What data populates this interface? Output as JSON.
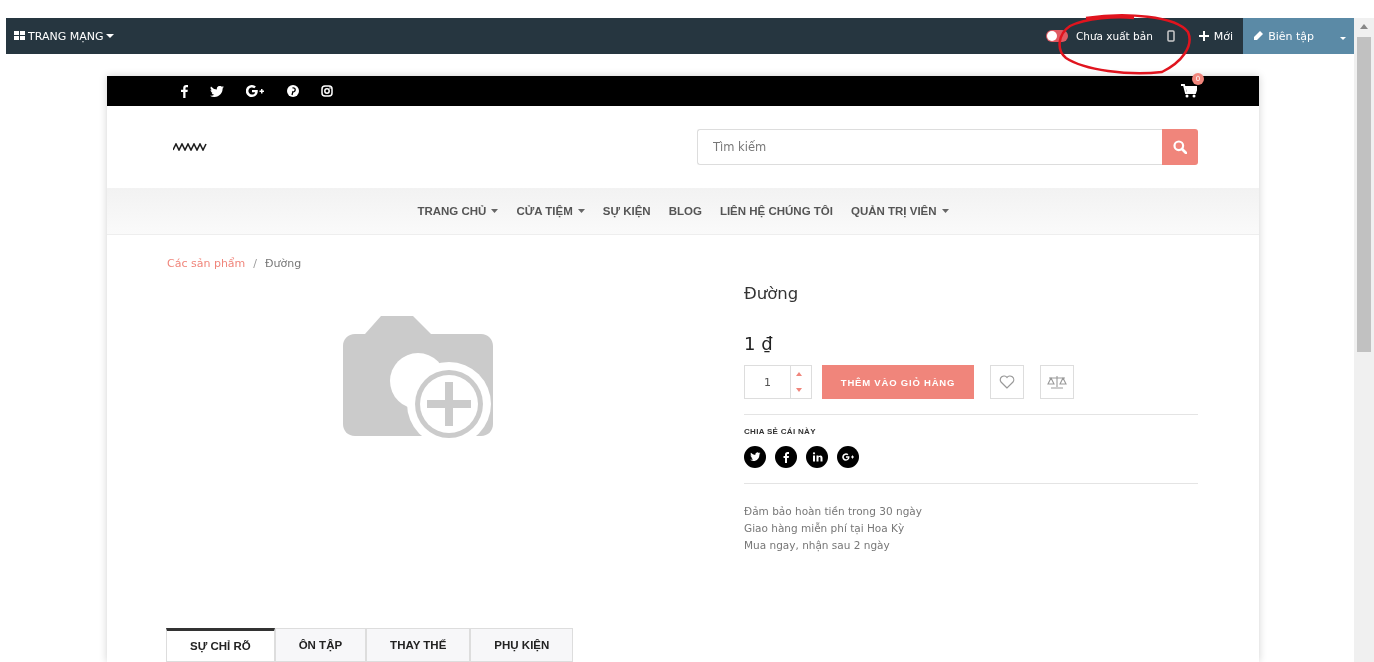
{
  "admin_bar": {
    "website_menu": "TRANG MẠNG",
    "publish_toggle": {
      "on": false,
      "label": "Chưa xuất bản"
    },
    "new_button": "Mới",
    "edit_button": "Biên tập"
  },
  "topbar": {
    "cart_count": "0"
  },
  "search": {
    "placeholder": "Tìm kiếm"
  },
  "nav": [
    {
      "label": "TRANG CHỦ",
      "dropdown": true
    },
    {
      "label": "CỬA TIỆM",
      "dropdown": true
    },
    {
      "label": "SỰ KIỆN",
      "dropdown": false
    },
    {
      "label": "BLOG",
      "dropdown": false
    },
    {
      "label": "LIÊN HỆ CHÚNG TÔI",
      "dropdown": false
    },
    {
      "label": "QUẢN TRỊ VIÊN",
      "dropdown": true
    }
  ],
  "breadcrumb_separator": "/",
  "breadcrumb": [
    {
      "label": "Các sản phẩm",
      "link": true
    },
    {
      "label": "Đường",
      "link": false
    }
  ],
  "product": {
    "name": "Đường",
    "price": "1",
    "currency": "₫",
    "quantity": "1",
    "add_to_cart": "THÊM VÀO GIỎ HÀNG",
    "share_title": "CHIA SẺ CÁI NÀY",
    "benefits": [
      "Đảm bảo hoàn tiền trong 30 ngày",
      "Giao hàng miễn phí tại Hoa Kỳ",
      "Mua ngay, nhận sau 2 ngày"
    ]
  },
  "tabs": [
    {
      "label": "SỰ CHỈ RÕ",
      "selected": true
    },
    {
      "label": "ÔN TẬP",
      "selected": false
    },
    {
      "label": "THAY THẾ",
      "selected": false
    },
    {
      "label": "PHỤ KIỆN",
      "selected": false
    }
  ]
}
